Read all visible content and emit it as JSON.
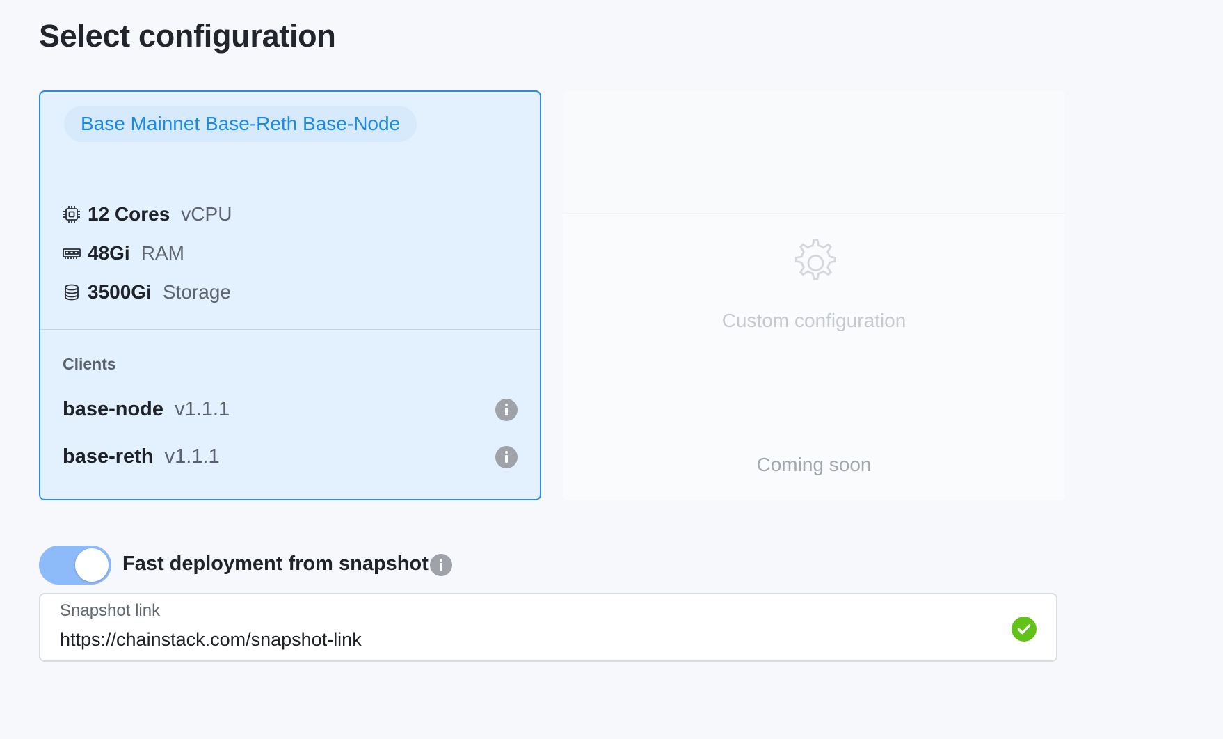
{
  "page": {
    "title": "Select configuration"
  },
  "config_card": {
    "name": "Base Mainnet Base-Reth Base-Node",
    "specs": [
      {
        "icon": "cpu-icon",
        "value": "12 Cores",
        "unit": "vCPU"
      },
      {
        "icon": "memory-icon",
        "value": "48Gi",
        "unit": "RAM"
      },
      {
        "icon": "database-icon",
        "value": "3500Gi",
        "unit": "Storage"
      }
    ],
    "clients_title": "Clients",
    "clients": [
      {
        "name": "base-node",
        "version": "v1.1.1"
      },
      {
        "name": "base-reth",
        "version": "v1.1.1"
      }
    ],
    "accent_color": "#2d8ae8"
  },
  "custom_card": {
    "label": "Custom configuration",
    "status": "Coming soon",
    "icon": "gear-icon"
  },
  "snapshot": {
    "toggle_label": "Fast deployment from snapshot",
    "toggle_on": true,
    "field_label": "Snapshot link",
    "field_value": "https://chainstack.com/snapshot-link",
    "valid": true,
    "valid_color": "#62c21a"
  }
}
